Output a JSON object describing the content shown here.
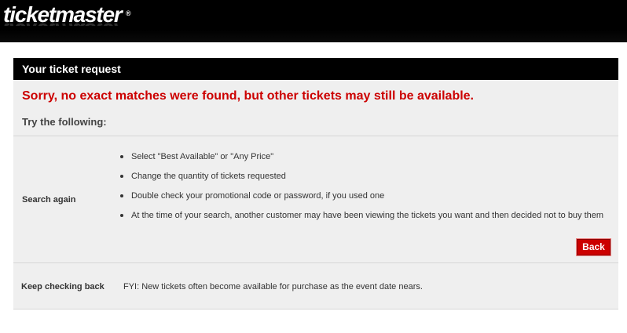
{
  "header": {
    "logo_text": "ticketmaster",
    "logo_mark": "®"
  },
  "panel": {
    "title": "Your ticket request",
    "error_message": "Sorry, no exact matches were found, but other tickets may still be available.",
    "try_label": "Try the following:"
  },
  "search_again": {
    "label": "Search again",
    "tips": [
      "Select \"Best Available\" or \"Any Price\"",
      "Change the quantity of tickets requested",
      "Double check your promotional code or password, if you used one",
      "At the time of your search, another customer may have been viewing the tickets you want and then decided not to buy them"
    ],
    "back_label": "Back"
  },
  "keep_checking": {
    "label": "Keep checking back",
    "message": "FYI: New tickets often become available for purchase as the event date nears."
  },
  "colors": {
    "error_red": "#cc0000",
    "header_bg": "#000000",
    "panel_bg": "#efefef",
    "button_bg": "#cc0000"
  }
}
